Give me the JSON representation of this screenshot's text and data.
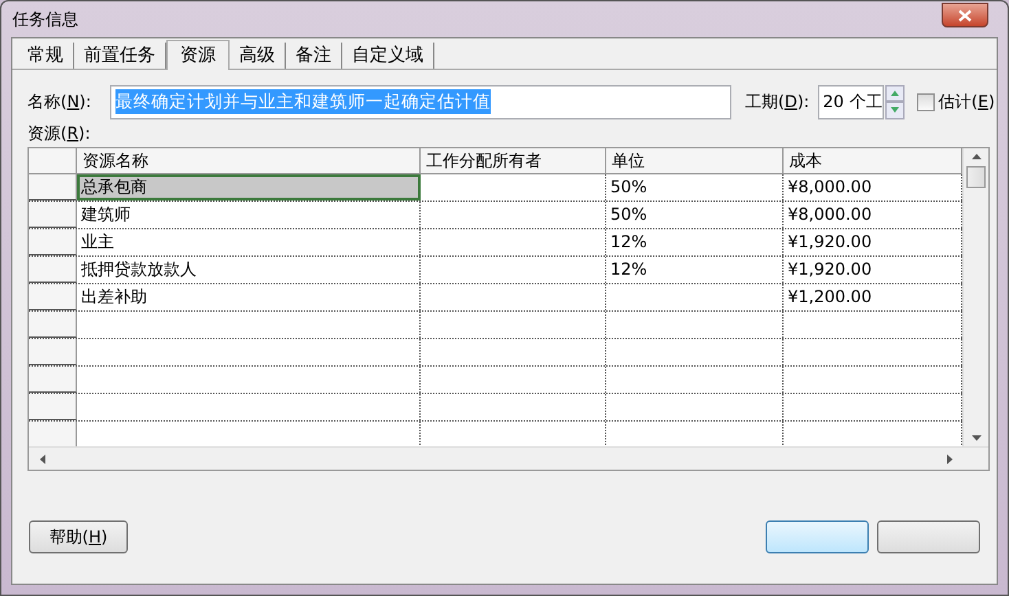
{
  "window": {
    "title": "任务信息"
  },
  "tabs": [
    {
      "label": "常规",
      "selected": false
    },
    {
      "label": "前置任务",
      "selected": false
    },
    {
      "label": "资源",
      "selected": true
    },
    {
      "label": "高级",
      "selected": false
    },
    {
      "label": "备注",
      "selected": false
    },
    {
      "label": "自定义域",
      "selected": false
    }
  ],
  "name_field": {
    "label": "名称(N):",
    "value": "最终确定计划并与业主和建筑师一起确定估计值"
  },
  "duration_field": {
    "label": "工期(D):",
    "value": "20 个工"
  },
  "estimated_checkbox": {
    "label": "估计(E)",
    "checked": false
  },
  "resources_label": "资源(R):",
  "table": {
    "columns": [
      "资源名称",
      "工作分配所有者",
      "单位",
      "成本"
    ],
    "rows": [
      {
        "cells": [
          "总承包商",
          "",
          "50%",
          "¥8,000.00"
        ],
        "selected": true
      },
      {
        "cells": [
          "建筑师",
          "",
          "50%",
          "¥8,000.00"
        ],
        "selected": false
      },
      {
        "cells": [
          "业主",
          "",
          "12%",
          "¥1,920.00"
        ],
        "selected": false
      },
      {
        "cells": [
          "抵押贷款放款人",
          "",
          "12%",
          "¥1,920.00"
        ],
        "selected": false
      },
      {
        "cells": [
          "出差补助",
          "",
          "",
          "¥1,200.00"
        ],
        "selected": false
      }
    ]
  },
  "help_button": "帮助(H)"
}
